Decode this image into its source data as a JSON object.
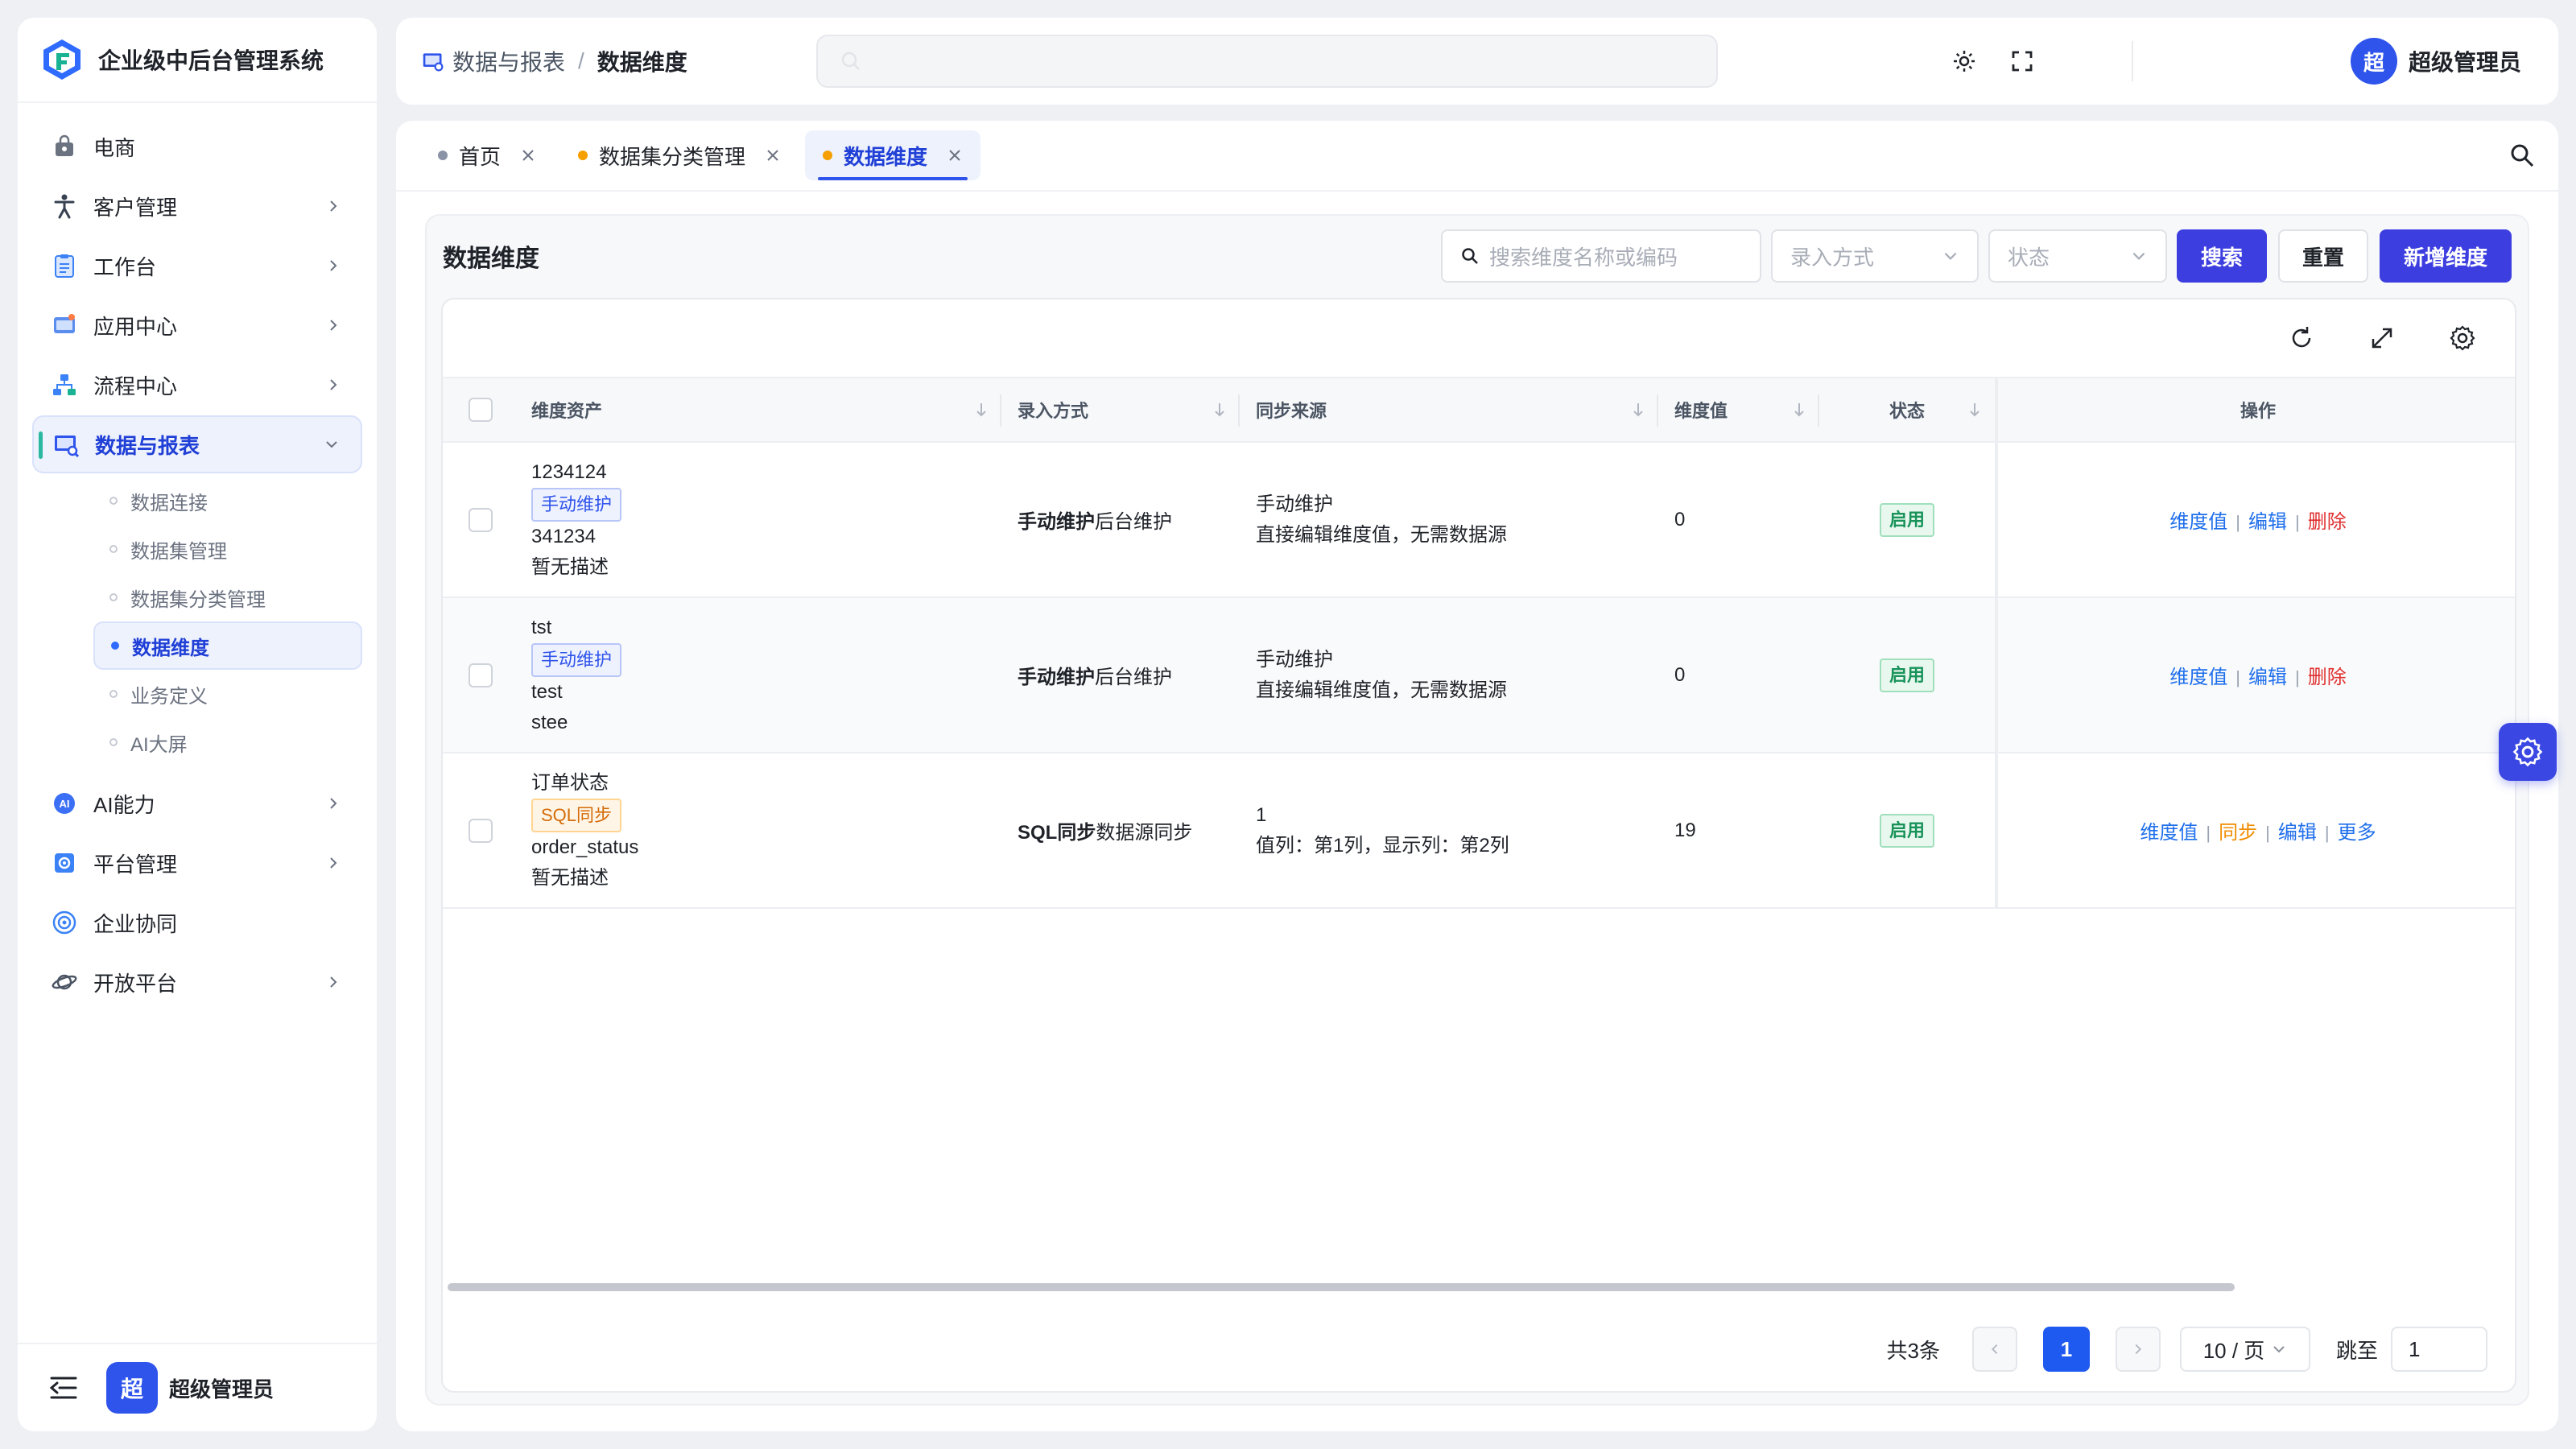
{
  "app": {
    "title": "企业级中后台管理系统"
  },
  "sidebar": {
    "items": [
      {
        "label": "电商",
        "icon": "shopping-bag-icon"
      },
      {
        "label": "客户管理",
        "icon": "accessibility-icon"
      },
      {
        "label": "工作台",
        "icon": "clipboard-icon"
      },
      {
        "label": "应用中心",
        "icon": "app-center-icon"
      },
      {
        "label": "流程中心",
        "icon": "flow-icon"
      },
      {
        "label": "数据与报表",
        "icon": "report-icon"
      },
      {
        "label": "AI能力",
        "icon": "ai-icon"
      },
      {
        "label": "平台管理",
        "icon": "platform-icon"
      },
      {
        "label": "企业协同",
        "icon": "collaboration-icon"
      },
      {
        "label": "开放平台",
        "icon": "planet-icon"
      }
    ],
    "sub_items": [
      "数据连接",
      "数据集管理",
      "数据集分类管理",
      "数据维度",
      "业务定义",
      "AI大屏"
    ],
    "footer_user": "超级管理员",
    "avatar_char": "超"
  },
  "header": {
    "breadcrumb": [
      "数据与报表",
      "数据维度"
    ],
    "user": "超级管理员",
    "avatar_char": "超"
  },
  "tabs": [
    {
      "label": "首页",
      "dot_color": "#8a94a6"
    },
    {
      "label": "数据集分类管理",
      "dot_color": "#f59f00"
    },
    {
      "label": "数据维度",
      "dot_color": "#f59f00"
    }
  ],
  "panel": {
    "title": "数据维度",
    "search_placeholder": "搜索维度名称或编码",
    "entry_select": "录入方式",
    "status_select": "状态",
    "search_btn": "搜索",
    "reset_btn": "重置",
    "new_btn": "新增维度"
  },
  "table": {
    "columns": [
      "维度资产",
      "录入方式",
      "同步来源",
      "维度值",
      "状态",
      "操作"
    ],
    "rows": [
      {
        "name": "1234124",
        "tag": "手动维护",
        "code": "341234",
        "desc": "暂无描述",
        "entry_bold": "手动维护",
        "entry_rest": "后台维护",
        "source1": "手动维护",
        "source2": "直接编辑维度值，无需数据源",
        "value": "0",
        "status": "启用",
        "ops": [
          "维度值",
          "编辑",
          "删除"
        ]
      },
      {
        "name": "tst",
        "tag": "手动维护",
        "code": "test",
        "desc": "stee",
        "entry_bold": "手动维护",
        "entry_rest": "后台维护",
        "source1": "手动维护",
        "source2": "直接编辑维度值，无需数据源",
        "value": "0",
        "status": "启用",
        "ops": [
          "维度值",
          "编辑",
          "删除"
        ]
      },
      {
        "name": "订单状态",
        "tag": "SQL同步",
        "code": "order_status",
        "desc": "暂无描述",
        "entry_bold": "SQL同步",
        "entry_rest": "数据源同步",
        "source1": "1",
        "source2": "值列：第1列，显示列：第2列",
        "value": "19",
        "status": "启用",
        "ops": [
          "维度值",
          "同步",
          "编辑",
          "更多"
        ]
      }
    ]
  },
  "pagination": {
    "total": "共3条",
    "current": "1",
    "page_size": "10 / 页",
    "jump_label": "跳至",
    "jump_value": "1"
  },
  "colors": {
    "primary": "#3d3ee0",
    "brand_blue": "#2f54eb",
    "accent_teal": "#2ab8a0"
  }
}
